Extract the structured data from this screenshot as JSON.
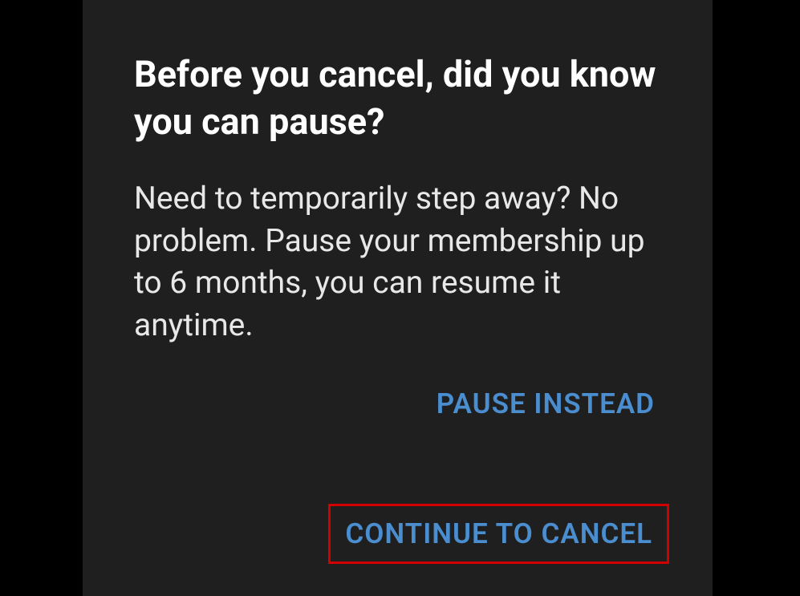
{
  "dialog": {
    "title": "Before you cancel, did you know you can pause?",
    "body": "Need to temporarily step away? No problem. Pause your membership up to 6 months, you can resume it anytime.",
    "actions": {
      "pause_label": "PAUSE INSTEAD",
      "cancel_label": "CONTINUE TO CANCEL"
    }
  }
}
